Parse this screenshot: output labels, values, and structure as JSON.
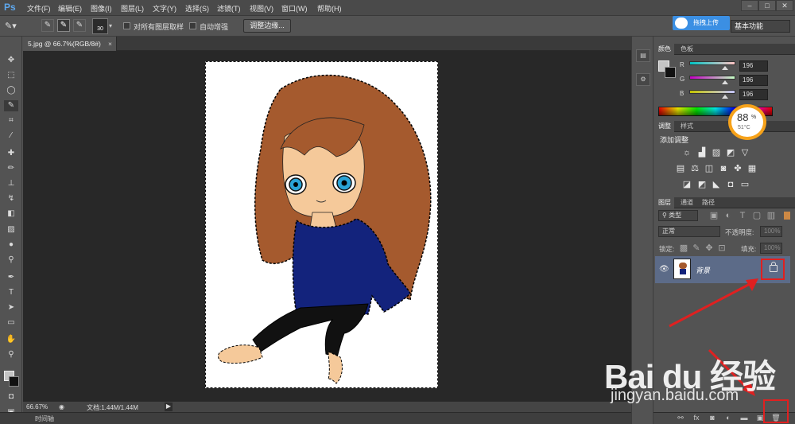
{
  "app": {
    "logo": "Ps"
  },
  "menu": [
    "文件(F)",
    "编辑(E)",
    "图像(I)",
    "图层(L)",
    "文字(Y)",
    "选择(S)",
    "滤镜(T)",
    "视图(V)",
    "窗口(W)",
    "帮助(H)"
  ],
  "options": {
    "brush_size": "30",
    "sample_all_layers": "对所有图层取样",
    "auto_enhance": "自动增强",
    "refine_edge": "调整边缘...",
    "workspace": "基本功能",
    "cloud_upload": "拖拽上传"
  },
  "document": {
    "tab_title": "5.jpg @ 66.7%(RGB/8#)",
    "zoom": "66.67%",
    "doc_size": "文档:1.44M/1.44M",
    "timeline": "时间轴"
  },
  "color_panel": {
    "tabs": [
      "颜色",
      "色板"
    ],
    "channels": [
      {
        "label": "R",
        "value": "196",
        "value_ratio": 0.77
      },
      {
        "label": "G",
        "value": "196",
        "value_ratio": 0.77
      },
      {
        "label": "B",
        "value": "196",
        "value_ratio": 0.77
      }
    ]
  },
  "adjust_panel": {
    "tabs": [
      "调整",
      "样式"
    ],
    "title": "添加调整"
  },
  "layers_panel": {
    "tabs": [
      "图层",
      "通道",
      "路径"
    ],
    "filter_kind": "类型",
    "blend_mode": "正常",
    "opacity_label": "不透明度:",
    "opacity_value": "100%",
    "lock_label": "锁定:",
    "fill_label": "填充:",
    "fill_value": "100%",
    "layers": [
      {
        "name": "背景",
        "locked": true,
        "visible": true
      }
    ]
  },
  "overlays": {
    "temperature_percent": "88",
    "temperature_percent_unit": "%",
    "temperature_c": "51°C",
    "watermark": "Bai du 经验",
    "watermark_url": "jingyan.baidu.com"
  },
  "colors": {
    "accent": "#5c6b88",
    "highlight": "#e02020",
    "hair": "#a55a2e",
    "shirt": "#13237c",
    "skin": "#f5c99a"
  }
}
